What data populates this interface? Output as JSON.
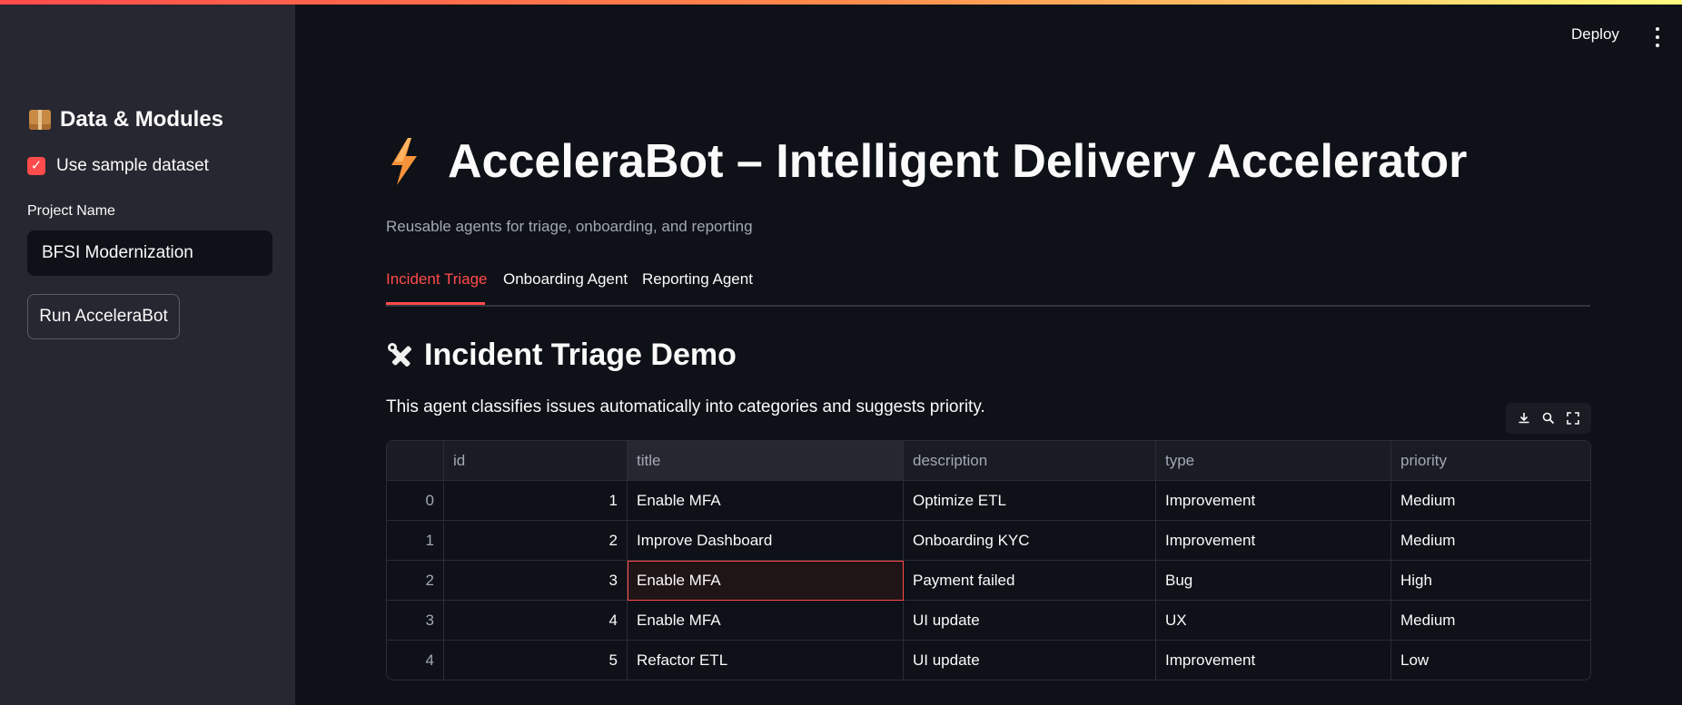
{
  "sidebar": {
    "header": "Data & Modules",
    "checkbox_label": "Use sample dataset",
    "checkbox_checked": true,
    "project_label": "Project Name",
    "project_value": "BFSI Modernization",
    "run_button": "Run AcceleraBot"
  },
  "topbar": {
    "deploy_label": "Deploy"
  },
  "main": {
    "title": "AcceleraBot – Intelligent Delivery Accelerator",
    "caption": "Reusable agents for triage, onboarding, and reporting",
    "tabs": [
      {
        "label": "Incident Triage",
        "active": true
      },
      {
        "label": "Onboarding Agent",
        "active": false
      },
      {
        "label": "Reporting Agent",
        "active": false
      }
    ],
    "section_title": "Incident Triage Demo",
    "description": "This agent classifies issues automatically into categories and suggests priority."
  },
  "table": {
    "columns": [
      "",
      "id",
      "title",
      "description",
      "type",
      "priority"
    ],
    "rows": [
      {
        "index": "0",
        "id": "1",
        "title": "Enable MFA",
        "description": "Optimize ETL",
        "type": "Improvement",
        "priority": "Medium"
      },
      {
        "index": "1",
        "id": "2",
        "title": "Improve Dashboard",
        "description": "Onboarding KYC",
        "type": "Improvement",
        "priority": "Medium"
      },
      {
        "index": "2",
        "id": "3",
        "title": "Enable MFA",
        "description": "Payment failed",
        "type": "Bug",
        "priority": "High"
      },
      {
        "index": "3",
        "id": "4",
        "title": "Enable MFA",
        "description": "UI update",
        "type": "UX",
        "priority": "Medium"
      },
      {
        "index": "4",
        "id": "5",
        "title": "Refactor ETL",
        "description": "UI update",
        "type": "Improvement",
        "priority": "Low"
      }
    ]
  },
  "colors": {
    "accent": "#ff4b4b",
    "background": "#0e1117",
    "sidebar": "#262730"
  },
  "icons": {
    "sidebar_header": "package-icon",
    "title": "lightning-icon",
    "section": "tools-icon",
    "toolbar": [
      "download-icon",
      "search-icon",
      "fullscreen-icon"
    ]
  }
}
